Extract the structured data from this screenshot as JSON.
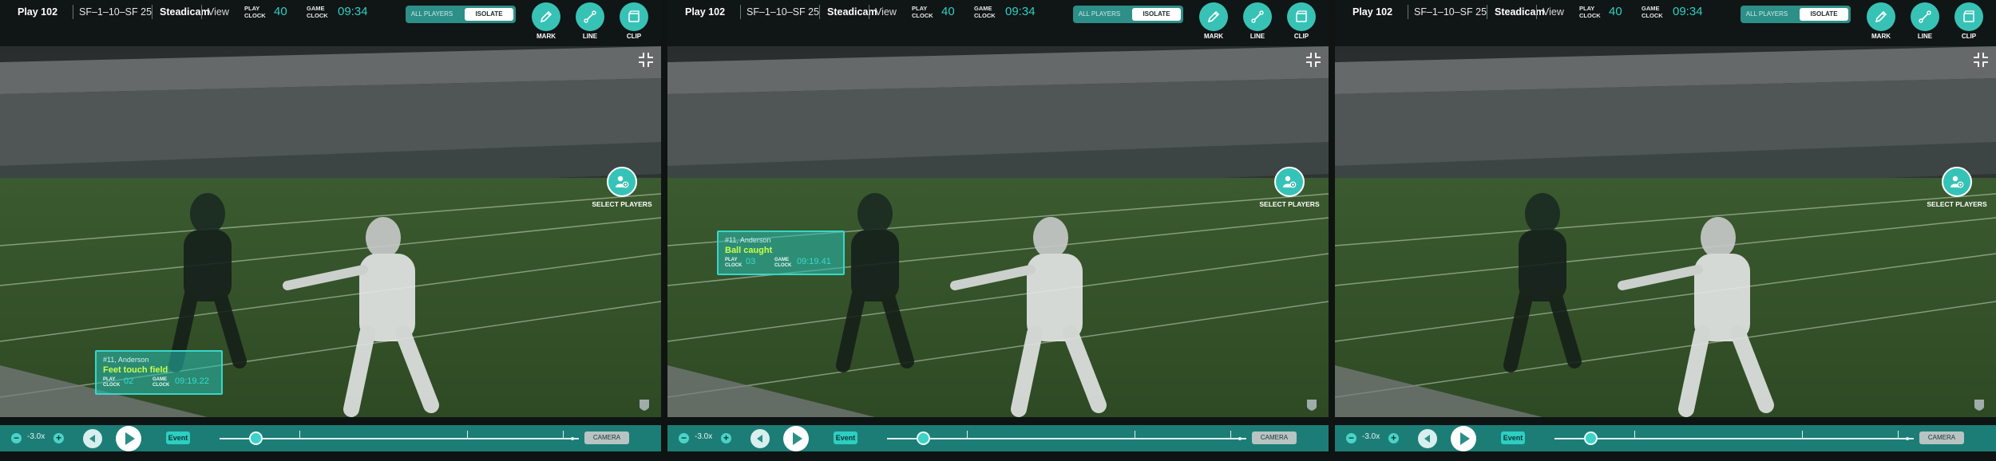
{
  "panels": [
    {
      "header": {
        "play": "Play 102",
        "play_info": "SF–1–10–SF 25",
        "camera_name": "Steadicam",
        "view_label": "View",
        "play_clock_label": "PLAY CLOCK",
        "play_clock_value": "40",
        "game_clock_label": "GAME CLOCK",
        "game_clock_value": "09:34"
      },
      "toggle": {
        "all_players": "ALL PLAYERS",
        "isolate": "ISOLATE"
      },
      "tools": {
        "mark": "MARK",
        "line": "LINE",
        "clip": "CLIP"
      },
      "overlay": {
        "select_players": "SELECT PLAYERS"
      },
      "callout": {
        "player": "#11, Anderson",
        "event": "Feet touch field",
        "play_clock_label": "PLAY CLOCK",
        "play_clock_value": "02",
        "game_clock_label": "GAME CLOCK",
        "game_clock_value": "09:19.22"
      },
      "controls": {
        "speed": "-3.0x",
        "event_label": "Event",
        "camera_label": "CAMERA",
        "timeline_position": 0.1
      }
    },
    {
      "header": {
        "play": "Play 102",
        "play_info": "SF–1–10–SF 25",
        "camera_name": "Steadicam",
        "view_label": "View",
        "play_clock_label": "PLAY CLOCK",
        "play_clock_value": "40",
        "game_clock_label": "GAME CLOCK",
        "game_clock_value": "09:34"
      },
      "toggle": {
        "all_players": "ALL PLAYERS",
        "isolate": "ISOLATE"
      },
      "tools": {
        "mark": "MARK",
        "line": "LINE",
        "clip": "CLIP"
      },
      "overlay": {
        "select_players": "SELECT PLAYERS"
      },
      "callout": {
        "player": "#11, Anderson",
        "event": "Ball caught",
        "play_clock_label": "PLAY CLOCK",
        "play_clock_value": "03",
        "game_clock_label": "GAME CLOCK",
        "game_clock_value": "09:19.41"
      },
      "controls": {
        "speed": "-3.0x",
        "event_label": "Event",
        "camera_label": "CAMERA",
        "timeline_position": 0.1
      }
    },
    {
      "header": {
        "play": "Play 102",
        "play_info": "SF–1–10–SF 25",
        "camera_name": "Steadicam",
        "view_label": "View",
        "play_clock_label": "PLAY CLOCK",
        "play_clock_value": "40",
        "game_clock_label": "GAME CLOCK",
        "game_clock_value": "09:34"
      },
      "toggle": {
        "all_players": "ALL PLAYERS",
        "isolate": "ISOLATE"
      },
      "tools": {
        "mark": "MARK",
        "line": "LINE",
        "clip": "CLIP"
      },
      "overlay": {
        "select_players": "SELECT PLAYERS"
      },
      "controls": {
        "speed": "-3.0x",
        "event_label": "Event",
        "camera_label": "CAMERA",
        "timeline_position": 0.1
      }
    }
  ],
  "colors": {
    "accent": "#38c2b6",
    "bar": "#1c7d76",
    "callout_event": "#c7ff4a",
    "clock_value": "#2fd0c4"
  },
  "icons": [
    "pencil-icon",
    "line-tool-icon",
    "clip-icon",
    "users-icon",
    "collapse-icon",
    "rewind-icon",
    "play-icon",
    "zoom-out-icon",
    "zoom-in-icon",
    "nfl-logo-icon"
  ]
}
